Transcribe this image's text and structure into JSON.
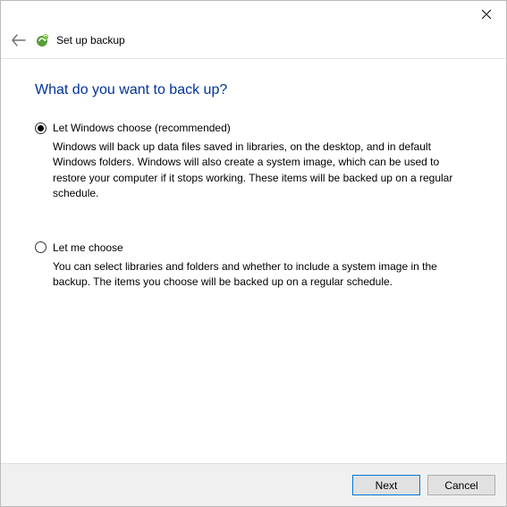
{
  "window": {
    "title": "Set up backup"
  },
  "page": {
    "heading": "What do you want to back up?"
  },
  "options": {
    "auto": {
      "label": "Let Windows choose (recommended)",
      "description": "Windows will back up data files saved in libraries, on the desktop, and in default Windows folders. Windows will also create a system image, which can be used to restore your computer if it stops working. These items will be backed up on a regular schedule."
    },
    "manual": {
      "label": "Let me choose",
      "description": "You can select libraries and folders and whether to include a system image in the backup. The items you choose will be backed up on a regular schedule."
    }
  },
  "footer": {
    "next": "Next",
    "cancel": "Cancel"
  }
}
